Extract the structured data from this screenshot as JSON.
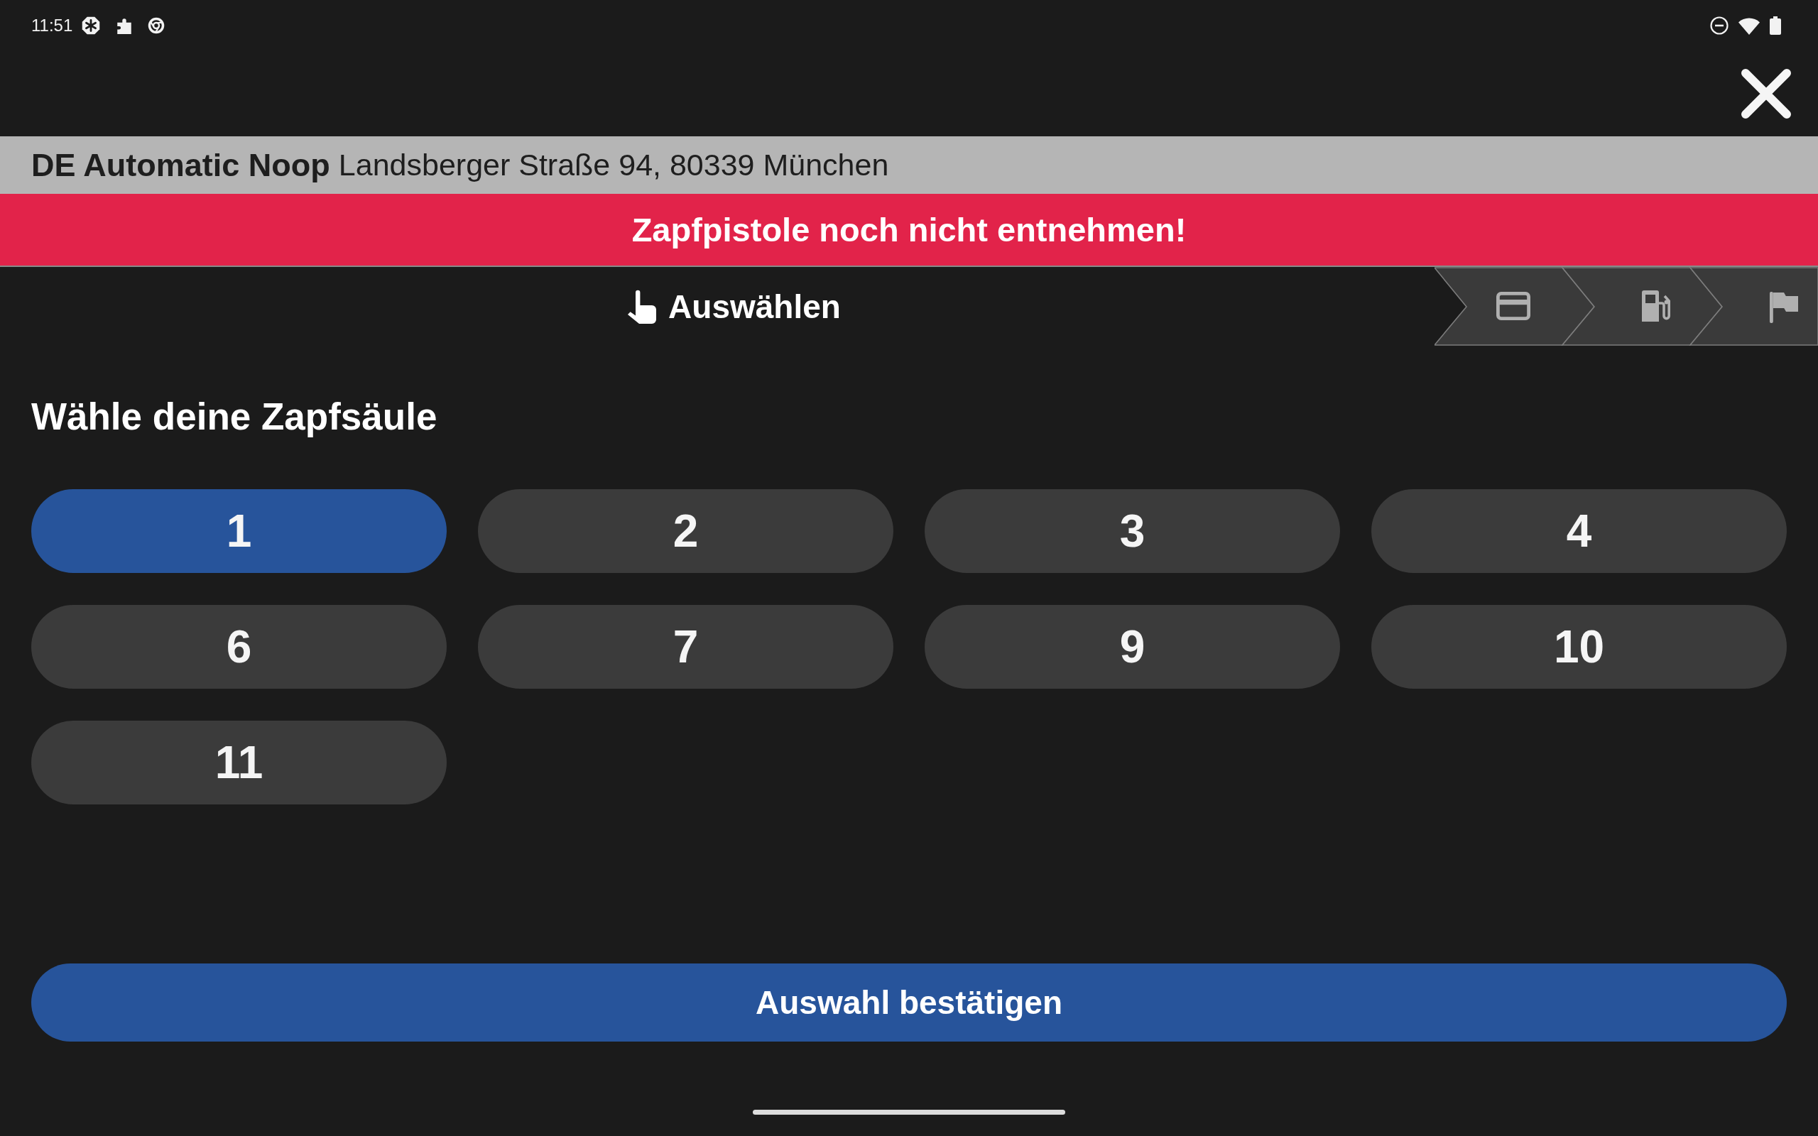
{
  "status_bar": {
    "time": "11:51"
  },
  "station": {
    "name": "DE Automatic Noop",
    "address": "Landsberger Straße 94, 80339 München"
  },
  "warning": "Zapfpistole noch nicht entnehmen!",
  "progress": {
    "current_step": "Auswählen"
  },
  "pump_selection": {
    "title": "Wähle deine Zapfsäule",
    "pumps": [
      {
        "label": "1",
        "selected": true
      },
      {
        "label": "2",
        "selected": false
      },
      {
        "label": "3",
        "selected": false
      },
      {
        "label": "4",
        "selected": false
      },
      {
        "label": "6",
        "selected": false
      },
      {
        "label": "7",
        "selected": false
      },
      {
        "label": "9",
        "selected": false
      },
      {
        "label": "10",
        "selected": false
      },
      {
        "label": "11",
        "selected": false
      }
    ]
  },
  "confirm_button": {
    "label": "Auswahl bestätigen"
  }
}
